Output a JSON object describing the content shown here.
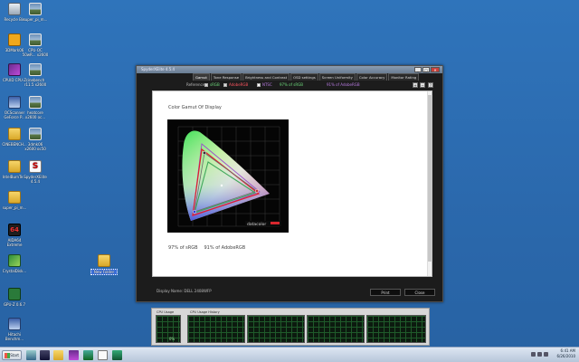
{
  "desktop": {
    "icons": [
      {
        "label": "Recycle Bin",
        "icon": "recycle-bin-icon"
      },
      {
        "label": "super_pi_m...",
        "icon": "image-file-icon"
      },
      {
        "label": "3DMark06",
        "icon": "chat-icon"
      },
      {
        "label": "CPU-OC 50wR... x2600",
        "icon": "image-file-icon"
      },
      {
        "label": "CPUID CPU-Z",
        "icon": "cpuz-icon"
      },
      {
        "label": "cinebench r11.5 x2600",
        "icon": "image-file-icon"
      },
      {
        "label": "OCScanner GeForce P...",
        "icon": "ocscanner-icon"
      },
      {
        "label": "heatcore x2600 oc...",
        "icon": "image-file-icon"
      },
      {
        "label": "CINEBENCH...",
        "icon": "folder-icon"
      },
      {
        "label": "3dmk06 x2600 oc50",
        "icon": "image-file-icon"
      },
      {
        "label": "IntelBurnTe...",
        "icon": "folder-icon"
      },
      {
        "label": "SpyderXElite 4.5.4",
        "icon": "spyder-icon"
      },
      {
        "label": "super_pi_m...",
        "icon": "folder-icon"
      },
      {
        "label": "AIDA64 Extreme",
        "icon": "aida64-icon"
      },
      {
        "label": "CrystalDisk...",
        "icon": "crystaldisk-icon"
      },
      {
        "label": "New Folder",
        "icon": "folder-icon"
      },
      {
        "label": "GPU-Z 0.6.7",
        "icon": "gpuz-icon"
      },
      {
        "label": "Hitachi Benchm...",
        "icon": "hdtune-icon"
      }
    ]
  },
  "app": {
    "title": "SpyderXElite 4.5.4",
    "tabs": [
      "Gamut",
      "Tone Response",
      "Brightness and Contrast",
      "OSD settings",
      "Screen Uniformity",
      "Color Accuracy",
      "Monitor Rating"
    ],
    "active_tab": 0,
    "reference": {
      "label": "Reference:",
      "options": [
        {
          "label": "sRGB",
          "checked": true
        },
        {
          "label": "AdobeRGB",
          "checked": true
        },
        {
          "label": "NTSC",
          "checked": false
        }
      ],
      "srgb_result": "97% of sRGB",
      "adobe_result": "91% of AdobeRGB"
    },
    "content_title": "Color Gamut Of Display",
    "chart_brand": "datacolor",
    "results": [
      "97% of sRGB",
      "91% of AdobeRGB"
    ],
    "display_name": "Display Name: DELL 2408WFP",
    "print_label": "Print",
    "close_label": "Close",
    "colors": {
      "srgb": "#3fa85a",
      "adobergb": "#e0202a",
      "ntsc": "#9b4fc9",
      "display": "#c03a3a"
    }
  },
  "cpu_gadget": {
    "usage_label": "CPU Usage",
    "usage_value": "0%",
    "history_label": "CPU Usage History"
  },
  "taskbar": {
    "start_label": "Start",
    "time": "6:41 AM",
    "date": "6/26/2010"
  }
}
